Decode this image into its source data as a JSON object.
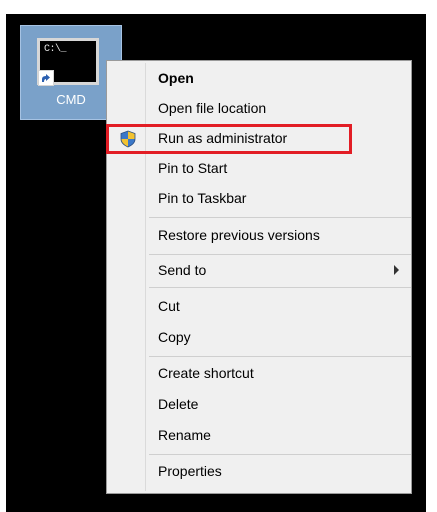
{
  "desktop": {
    "shortcut": {
      "label": "CMD",
      "icon": "command-prompt-icon",
      "overlay_icon": "shortcut-arrow-icon",
      "glyph": "C:\\_"
    }
  },
  "context_menu": {
    "items": [
      {
        "label": "Open",
        "default": true
      },
      {
        "label": "Open file location"
      },
      {
        "label": "Run as administrator",
        "icon": "uac-shield-icon",
        "highlighted": true
      },
      {
        "label": "Pin to Start"
      },
      {
        "label": "Pin to Taskbar"
      },
      {
        "label": "Restore previous versions"
      },
      {
        "label": "Send to",
        "submenu": true
      },
      {
        "label": "Cut"
      },
      {
        "label": "Copy"
      },
      {
        "label": "Create shortcut"
      },
      {
        "label": "Delete"
      },
      {
        "label": "Rename"
      },
      {
        "label": "Properties"
      }
    ]
  },
  "colors": {
    "highlight_border": "#e21d25",
    "selected_tile": "#7aa1c9",
    "menu_background": "#f0f0f0",
    "desktop_background": "#000000"
  }
}
